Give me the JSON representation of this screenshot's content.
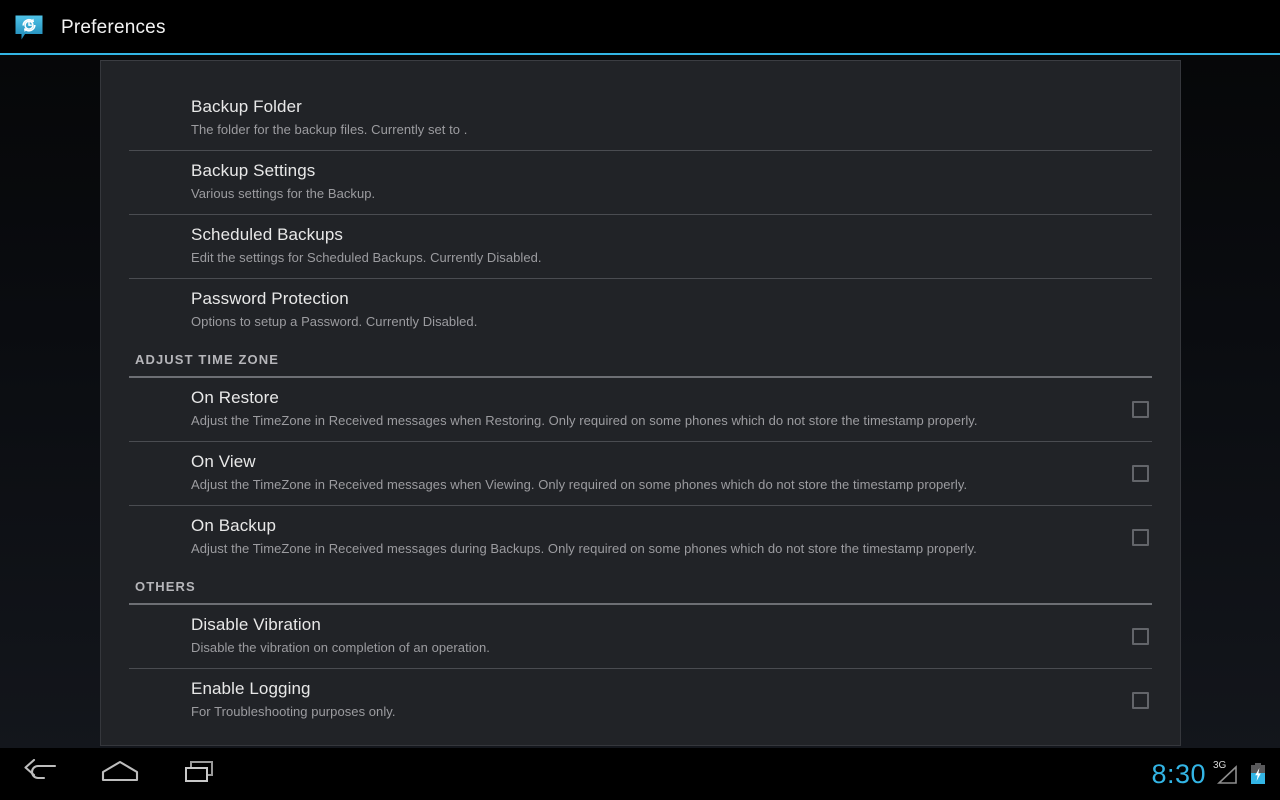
{
  "window": {
    "title": "Preferences",
    "app_icon": "sms-backup-restore-icon",
    "accent_color": "#33b5e5"
  },
  "statusbar": {
    "clock": "8:30",
    "network_type": "3G",
    "signal_icon": "signal-triangle-icon",
    "battery_icon": "battery-charging-icon"
  },
  "navbar": {
    "back_label": "Back",
    "home_label": "Home",
    "recents_label": "Recent apps",
    "back_icon": "back-arrow-icon",
    "home_icon": "home-icon",
    "recents_icon": "recents-icon"
  },
  "preferences": [
    {
      "kind": "item",
      "name": "backup-folder",
      "title": "Backup Folder",
      "summary": "The folder for the backup files. Currently set to ."
    },
    {
      "kind": "item",
      "name": "backup-settings",
      "title": "Backup Settings",
      "summary": "Various settings for the Backup."
    },
    {
      "kind": "item",
      "name": "scheduled-backups",
      "title": "Scheduled Backups",
      "summary": "Edit the settings for Scheduled Backups. Currently Disabled."
    },
    {
      "kind": "item",
      "name": "password-protection",
      "title": "Password Protection",
      "summary": "Options to setup a Password. Currently Disabled."
    },
    {
      "kind": "section",
      "name": "adjust-time-zone",
      "label": "ADJUST TIME ZONE"
    },
    {
      "kind": "checkbox",
      "name": "on-restore",
      "title": "On Restore",
      "summary": "Adjust the TimeZone in Received messages when Restoring. Only required on some phones which do not store the timestamp properly.",
      "checked": false
    },
    {
      "kind": "checkbox",
      "name": "on-view",
      "title": "On View",
      "summary": "Adjust the TimeZone in Received messages when Viewing. Only required on some phones which do not store the timestamp properly.",
      "checked": false
    },
    {
      "kind": "checkbox",
      "name": "on-backup",
      "title": "On Backup",
      "summary": "Adjust the TimeZone in Received messages during Backups. Only required on some phones which do not store the timestamp properly.",
      "checked": false
    },
    {
      "kind": "section",
      "name": "others",
      "label": "OTHERS"
    },
    {
      "kind": "checkbox",
      "name": "disable-vibration",
      "title": "Disable Vibration",
      "summary": "Disable the vibration on completion of an operation.",
      "checked": false
    },
    {
      "kind": "checkbox",
      "name": "enable-logging",
      "title": "Enable Logging",
      "summary": "For Troubleshooting purposes only.",
      "checked": false
    }
  ]
}
